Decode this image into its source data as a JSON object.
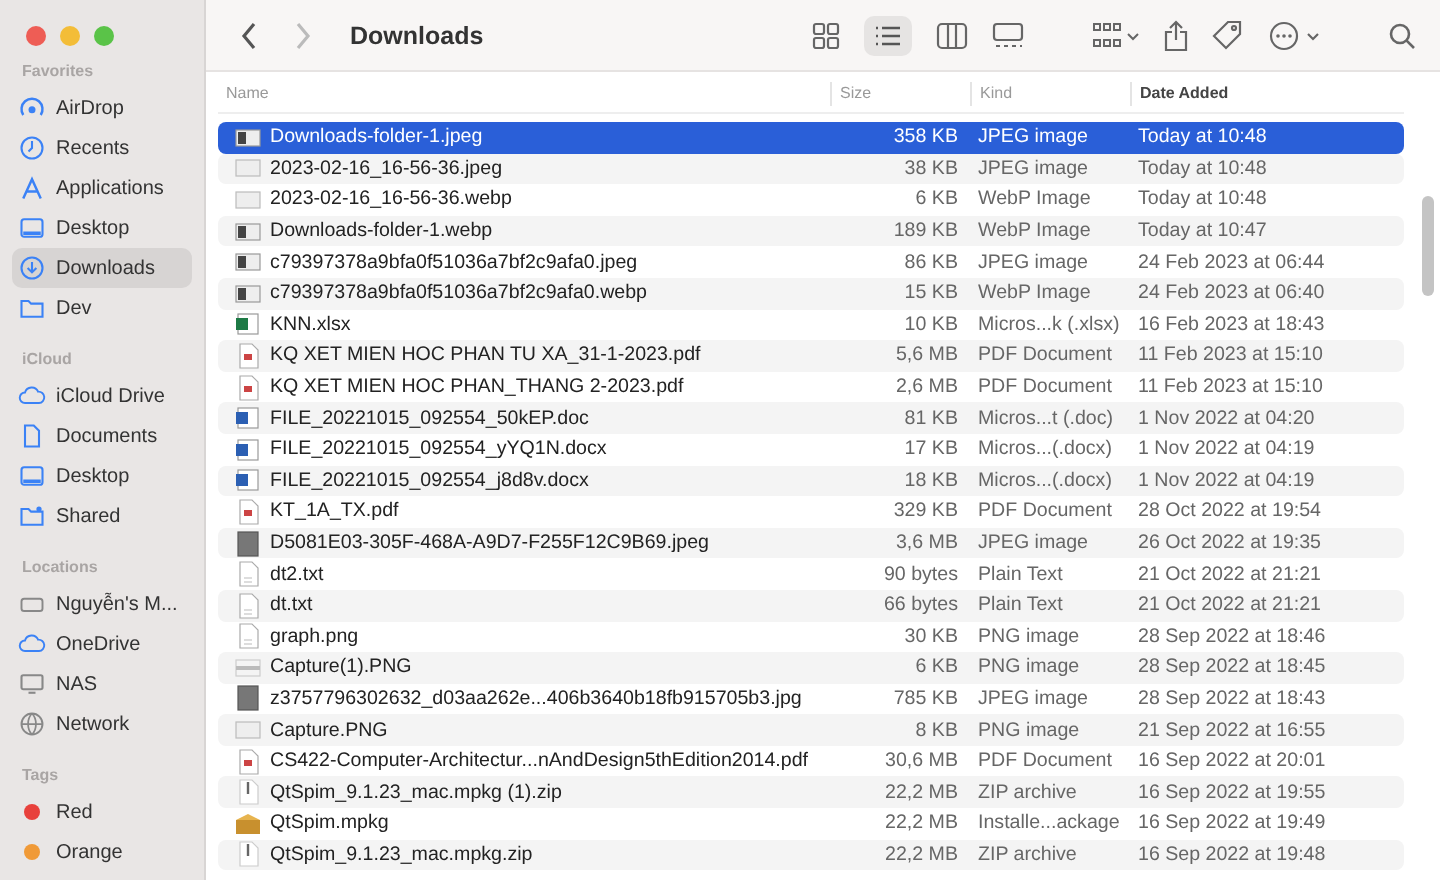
{
  "window": {
    "title": "Downloads"
  },
  "sidebar": [
    {
      "heading": "Favorites",
      "items": [
        {
          "label": "AirDrop",
          "kind": "airdrop",
          "selected": false
        },
        {
          "label": "Recents",
          "kind": "clock",
          "selected": false
        },
        {
          "label": "Applications",
          "kind": "apps",
          "selected": false
        },
        {
          "label": "Desktop",
          "kind": "desktop",
          "selected": false
        },
        {
          "label": "Downloads",
          "kind": "download",
          "selected": true
        },
        {
          "label": "Dev",
          "kind": "folder",
          "selected": false
        }
      ]
    },
    {
      "heading": "iCloud",
      "items": [
        {
          "label": "iCloud Drive",
          "kind": "cloud",
          "selected": false
        },
        {
          "label": "Documents",
          "kind": "document",
          "selected": false
        },
        {
          "label": "Desktop",
          "kind": "desktop",
          "selected": false
        },
        {
          "label": "Shared",
          "kind": "shared",
          "selected": false
        }
      ]
    },
    {
      "heading": "Locations",
      "items": [
        {
          "label": "Nguyễn's M...",
          "kind": "laptop",
          "selected": false
        },
        {
          "label": "OneDrive",
          "kind": "cloud",
          "selected": false
        },
        {
          "label": "NAS",
          "kind": "display",
          "selected": false
        },
        {
          "label": "Network",
          "kind": "globe",
          "selected": false
        }
      ]
    },
    {
      "heading": "Tags",
      "items": [
        {
          "label": "Red",
          "kind": "tag",
          "color": "#e8413c",
          "selected": false
        },
        {
          "label": "Orange",
          "kind": "tag",
          "color": "#f09a37",
          "selected": false
        }
      ]
    }
  ],
  "columns": [
    "Name",
    "Size",
    "Kind",
    "Date Added"
  ],
  "rows": [
    {
      "name": "Downloads-folder-1.jpeg",
      "size": "358 KB",
      "kind_text": "JPEG image",
      "date": "Today at 10:48",
      "kind": "image",
      "selected": true
    },
    {
      "name": "2023-02-16_16-56-36.jpeg",
      "size": "38 KB",
      "kind_text": "JPEG image",
      "date": "Today at 10:48",
      "kind": "blank",
      "selected": false
    },
    {
      "name": "2023-02-16_16-56-36.webp",
      "size": "6 KB",
      "kind_text": "WebP Image",
      "date": "Today at 10:48",
      "kind": "blank",
      "selected": false
    },
    {
      "name": "Downloads-folder-1.webp",
      "size": "189 KB",
      "kind_text": "WebP Image",
      "date": "Today at 10:47",
      "kind": "image",
      "selected": false
    },
    {
      "name": "c79397378a9bfa0f51036a7bf2c9afa0.jpeg",
      "size": "86 KB",
      "kind_text": "JPEG image",
      "date": "24 Feb 2023 at 06:44",
      "kind": "image",
      "selected": false
    },
    {
      "name": "c79397378a9bfa0f51036a7bf2c9afa0.webp",
      "size": "15 KB",
      "kind_text": "WebP Image",
      "date": "24 Feb 2023 at 06:40",
      "kind": "image",
      "selected": false
    },
    {
      "name": "KNN.xlsx",
      "size": "10 KB",
      "kind_text": "Micros...k (.xlsx)",
      "date": "16 Feb 2023 at 18:43",
      "kind": "sheet",
      "selected": false
    },
    {
      "name": "KQ XET MIEN HOC PHAN TU XA_31-1-2023.pdf",
      "size": "5,6 MB",
      "kind_text": "PDF Document",
      "date": "11 Feb 2023 at 15:10",
      "kind": "pdf",
      "selected": false
    },
    {
      "name": "KQ XET MIEN HOC PHAN_THANG 2-2023.pdf",
      "size": "2,6 MB",
      "kind_text": "PDF Document",
      "date": "11 Feb 2023 at 15:10",
      "kind": "pdf",
      "selected": false
    },
    {
      "name": "FILE_20221015_092554_50kEP.doc",
      "size": "81 KB",
      "kind_text": "Micros...t (.doc)",
      "date": "1 Nov 2022 at 04:20",
      "kind": "word",
      "selected": false
    },
    {
      "name": "FILE_20221015_092554_yYQ1N.docx",
      "size": "17 KB",
      "kind_text": "Micros...(.docx)",
      "date": "1 Nov 2022 at 04:19",
      "kind": "word",
      "selected": false
    },
    {
      "name": "FILE_20221015_092554_j8d8v.docx",
      "size": "18 KB",
      "kind_text": "Micros...(.docx)",
      "date": "1 Nov 2022 at 04:19",
      "kind": "word",
      "selected": false
    },
    {
      "name": "KT_1A_TX.pdf",
      "size": "329 KB",
      "kind_text": "PDF Document",
      "date": "28 Oct 2022 at 19:54",
      "kind": "pdf",
      "selected": false
    },
    {
      "name": "D5081E03-305F-468A-A9D7-F255F12C9B69.jpeg",
      "size": "3,6 MB",
      "kind_text": "JPEG image",
      "date": "26 Oct 2022 at 19:35",
      "kind": "photo",
      "selected": false
    },
    {
      "name": "dt2.txt",
      "size": "90 bytes",
      "kind_text": "Plain Text",
      "date": "21 Oct 2022 at 21:21",
      "kind": "text",
      "selected": false
    },
    {
      "name": "dt.txt",
      "size": "66 bytes",
      "kind_text": "Plain Text",
      "date": "21 Oct 2022 at 21:21",
      "kind": "text",
      "selected": false
    },
    {
      "name": "graph.png",
      "size": "30 KB",
      "kind_text": "PNG image",
      "date": "28 Sep 2022 at 18:46",
      "kind": "text",
      "selected": false
    },
    {
      "name": "Capture(1).PNG",
      "size": "6 KB",
      "kind_text": "PNG image",
      "date": "28 Sep 2022 at 18:45",
      "kind": "strip",
      "selected": false
    },
    {
      "name": "z3757796302632_d03aa262e...406b3640b18fb915705b3.jpg",
      "size": "785 KB",
      "kind_text": "JPEG image",
      "date": "28 Sep 2022 at 18:43",
      "kind": "photo",
      "selected": false
    },
    {
      "name": "Capture.PNG",
      "size": "8 KB",
      "kind_text": "PNG image",
      "date": "21 Sep 2022 at 16:55",
      "kind": "blank",
      "selected": false
    },
    {
      "name": "CS422-Computer-Architectur...nAndDesign5thEdition2014.pdf",
      "size": "30,6 MB",
      "kind_text": "PDF Document",
      "date": "16 Sep 2022 at 20:01",
      "kind": "pdf",
      "selected": false
    },
    {
      "name": "QtSpim_9.1.23_mac.mpkg (1).zip",
      "size": "22,2 MB",
      "kind_text": "ZIP archive",
      "date": "16 Sep 2022 at 19:55",
      "kind": "zip",
      "selected": false
    },
    {
      "name": "QtSpim.mpkg",
      "size": "22,2 MB",
      "kind_text": "Installe...ackage",
      "date": "16 Sep 2022 at 19:49",
      "kind": "package",
      "selected": false
    },
    {
      "name": "QtSpim_9.1.23_mac.mpkg.zip",
      "size": "22,2 MB",
      "kind_text": "ZIP archive",
      "date": "16 Sep 2022 at 19:48",
      "kind": "zip",
      "selected": false
    }
  ]
}
